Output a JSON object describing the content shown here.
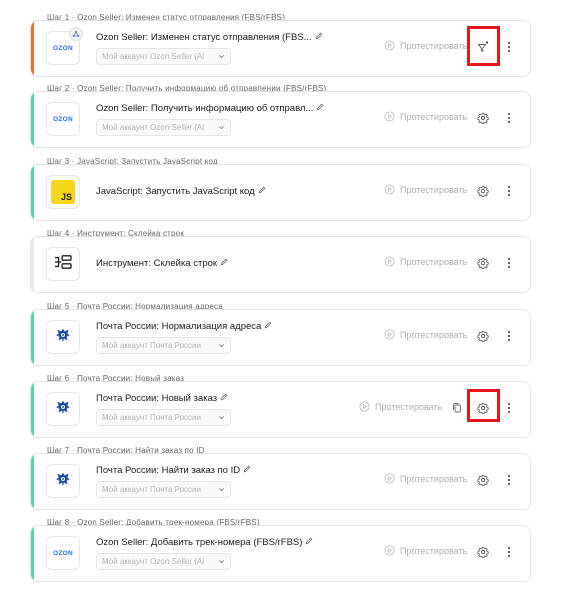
{
  "labels": {
    "test": "Протестировать"
  },
  "colors": {
    "accent_trigger": "#f06a3c",
    "accent_action": "#4fd8b0",
    "accent_tool": "#e8e8e8",
    "highlight": "#e8161a"
  },
  "steps": [
    {
      "caption": "Шаг 1 · Ozon Seller: Изменен статус отправления (FBS/rFBS)",
      "title": "Ozon Seller: Изменен статус отправления (FBS...",
      "account": "Мой аккаунт Ozon Seller (Al",
      "app": "ozon",
      "logo_text": "OZON",
      "kind": "trigger",
      "badge_icon": "share-nodes-icon",
      "action_icon": "filter-icon",
      "highlighted": true
    },
    {
      "caption": "Шаг 2 · Ozon Seller: Получить информацию об отправлении (FBS/rFBS)",
      "title": "Ozon Seller: Получить информацию об отправл...",
      "account": "Мой аккаунт Ozon Seller (Al",
      "app": "ozon",
      "logo_text": "OZON",
      "kind": "action",
      "action_icon": "gear-icon",
      "highlighted": false
    },
    {
      "caption": "Шаг 3 · JavaScript: Запустить JavaScript код",
      "title": "JavaScript: Запустить JavaScript код",
      "account": null,
      "app": "js",
      "logo_text": "JS",
      "kind": "action",
      "action_icon": "gear-icon",
      "highlighted": false
    },
    {
      "caption": "Шаг 4 · Инструмент: Склейка строк",
      "title": "Инструмент: Склейка строк",
      "account": null,
      "app": "tool",
      "logo_text": "",
      "kind": "tool",
      "action_icon": "gear-icon",
      "highlighted": false
    },
    {
      "caption": "Шаг 5 · Почта России: Нормализация адреса",
      "title": "Почта России: Нормализация адреса",
      "account": "Мой аккаунт Почта России",
      "app": "pochta",
      "logo_text": "",
      "kind": "action",
      "action_icon": "gear-icon",
      "highlighted": false
    },
    {
      "caption": "Шаг 6 · Почта России: Новый заказ",
      "title": "Почта России: Новый заказ",
      "account": "Мой аккаунт Почта России",
      "app": "pochta",
      "logo_text": "",
      "kind": "action",
      "action_icon": "gear-icon",
      "extra_icon": "copy-icon",
      "highlighted": true
    },
    {
      "caption": "Шаг 7 · Почта России: Найти заказ по ID",
      "title": "Почта России: Найти заказ по ID",
      "account": "Мой аккаунт Почта России",
      "app": "pochta",
      "logo_text": "",
      "kind": "action",
      "action_icon": "gear-icon",
      "highlighted": false
    },
    {
      "caption": "Шаг 8 · Ozon Seller: Добавить трек-номера (FBS/rFBS)",
      "title": "Ozon Seller: Добавить трек-номера (FBS/rFBS)",
      "account": "Мой аккаунт Ozon Seller (Al",
      "app": "ozon",
      "logo_text": "OZON",
      "kind": "action",
      "action_icon": "gear-icon",
      "highlighted": false
    }
  ]
}
